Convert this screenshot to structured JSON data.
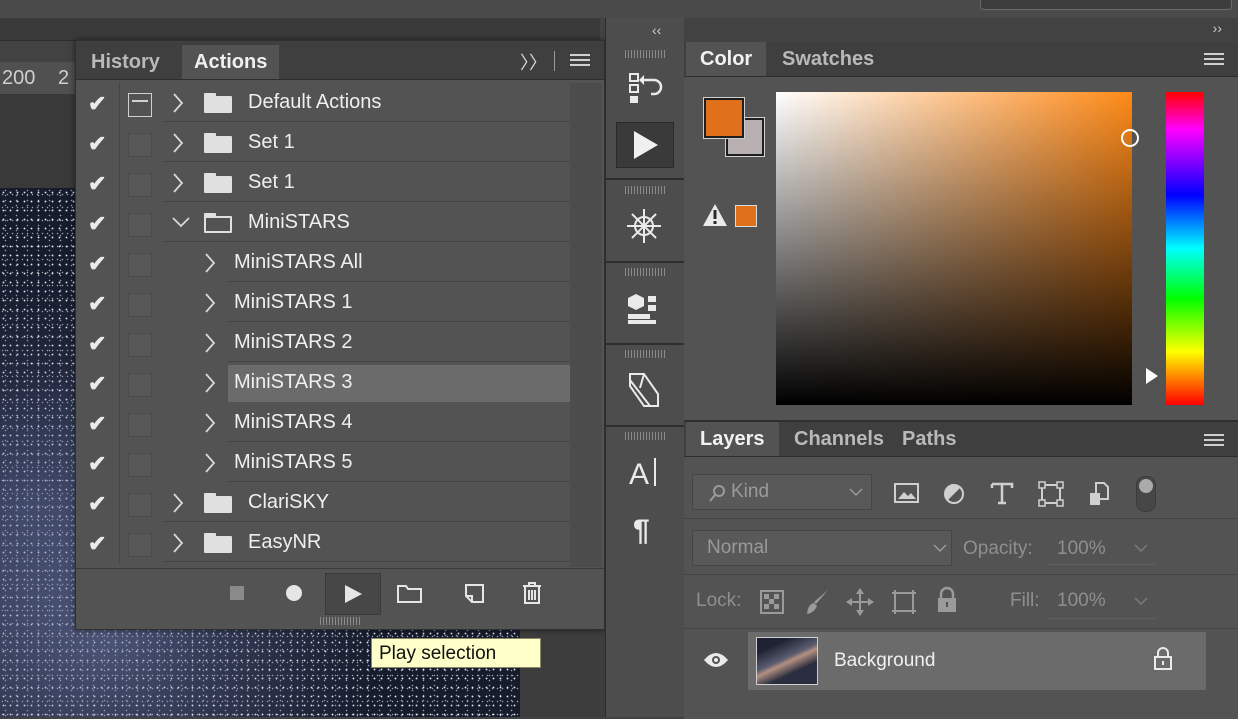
{
  "canvas": {
    "ruler_labels": [
      "200",
      "2"
    ]
  },
  "actions_panel": {
    "tabs": [
      {
        "label": "History",
        "active": false
      },
      {
        "label": "Actions",
        "active": true
      }
    ],
    "collapse_glyph": "〉〉",
    "items": [
      {
        "label": "Default Actions",
        "checked": true,
        "dialog_icon": true,
        "type": "set",
        "expanded": false,
        "indent": 0,
        "selected": false
      },
      {
        "label": "Set 1",
        "checked": true,
        "dialog_icon": false,
        "type": "set",
        "expanded": false,
        "indent": 0,
        "selected": false
      },
      {
        "label": "Set 1",
        "checked": true,
        "dialog_icon": false,
        "type": "set",
        "expanded": false,
        "indent": 0,
        "selected": false
      },
      {
        "label": "MiniSTARS",
        "checked": true,
        "dialog_icon": false,
        "type": "set",
        "expanded": true,
        "indent": 0,
        "selected": false
      },
      {
        "label": "MiniSTARS All",
        "checked": true,
        "dialog_icon": false,
        "type": "action",
        "expanded": false,
        "indent": 1,
        "selected": false
      },
      {
        "label": "MiniSTARS 1",
        "checked": true,
        "dialog_icon": false,
        "type": "action",
        "expanded": false,
        "indent": 1,
        "selected": false
      },
      {
        "label": "MiniSTARS 2",
        "checked": true,
        "dialog_icon": false,
        "type": "action",
        "expanded": false,
        "indent": 1,
        "selected": false
      },
      {
        "label": "MiniSTARS 3",
        "checked": true,
        "dialog_icon": false,
        "type": "action",
        "expanded": false,
        "indent": 1,
        "selected": true
      },
      {
        "label": "MiniSTARS 4",
        "checked": true,
        "dialog_icon": false,
        "type": "action",
        "expanded": false,
        "indent": 1,
        "selected": false
      },
      {
        "label": "MiniSTARS 5",
        "checked": true,
        "dialog_icon": false,
        "type": "action",
        "expanded": false,
        "indent": 1,
        "selected": false
      },
      {
        "label": "ClariSKY",
        "checked": true,
        "dialog_icon": false,
        "type": "set",
        "expanded": false,
        "indent": 0,
        "selected": false
      },
      {
        "label": "EasyNR",
        "checked": true,
        "dialog_icon": false,
        "type": "set",
        "expanded": false,
        "indent": 0,
        "selected": false
      }
    ],
    "footer_buttons": [
      "stop-icon",
      "record-icon",
      "play-icon",
      "new-set-icon",
      "new-action-icon",
      "trash-icon"
    ]
  },
  "tooltip": {
    "text": "Play selection"
  },
  "dock": {
    "collapse_glyph": "‹‹",
    "icons": [
      "history-icon",
      "play-actions-icon",
      "brush-settings-icon",
      "3d-properties-icon",
      "clone-source-icon",
      "character-icon",
      "paragraph-icon"
    ]
  },
  "color_panel": {
    "collapse_glyph": "››",
    "tabs": [
      {
        "label": "Color",
        "active": true
      },
      {
        "label": "Swatches",
        "active": false
      }
    ],
    "foreground_color": "#e0701c",
    "background_color": "#b9b1b1",
    "hue_color": "#ff8a18"
  },
  "layers_panel": {
    "tabs": [
      {
        "label": "Layers",
        "active": true
      },
      {
        "label": "Channels",
        "active": false
      },
      {
        "label": "Paths",
        "active": false
      }
    ],
    "filter_kind": "Kind",
    "blend_mode": "Normal",
    "opacity_label": "Opacity:",
    "opacity_value": "100%",
    "lock_label": "Lock:",
    "fill_label": "Fill:",
    "fill_value": "100%",
    "layers": [
      {
        "name": "Background",
        "visible": true,
        "locked": true
      }
    ]
  }
}
